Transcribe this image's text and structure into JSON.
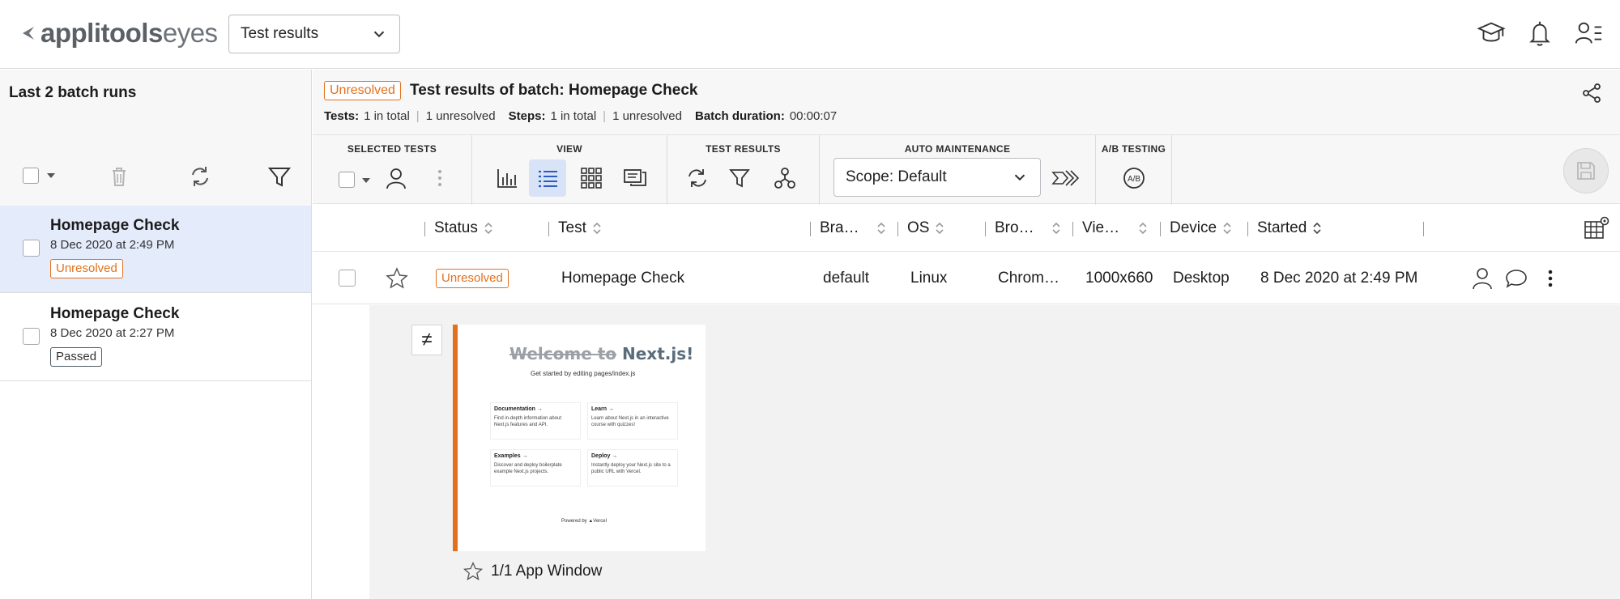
{
  "header": {
    "logo_brand": "applitools",
    "logo_product": "eyes",
    "page_select_value": "Test results",
    "icons": [
      "graduation-cap-icon",
      "bell-icon",
      "user-settings-icon"
    ]
  },
  "sidebar": {
    "title": "Last 2 batch runs",
    "batches": [
      {
        "name": "Homepage Check",
        "date": "8 Dec 2020 at 2:49 PM",
        "status": "Unresolved"
      },
      {
        "name": "Homepage Check",
        "date": "8 Dec 2020 at 2:27 PM",
        "status": "Passed"
      }
    ]
  },
  "batch": {
    "status": "Unresolved",
    "title": "Test results of batch:  Homepage Check",
    "tests_label": "Tests:",
    "tests_total": "1 in total",
    "tests_unresolved": "1 unresolved",
    "steps_label": "Steps:",
    "steps_total": "1 in total",
    "steps_unresolved": "1 unresolved",
    "duration_label": "Batch duration:",
    "duration_value": "00:00:07"
  },
  "toolbar": {
    "selected_tests_label": "SELECTED TESTS",
    "view_label": "VIEW",
    "test_results_label": "TEST RESULTS",
    "auto_maintenance_label": "AUTO MAINTENANCE",
    "ab_testing_label": "A/B TESTING",
    "scope_value": "Scope: Default"
  },
  "table": {
    "columns": [
      "Status",
      "Test",
      "Bra…",
      "OS",
      "Bro…",
      "Vie…",
      "Device",
      "Started"
    ],
    "rows": [
      {
        "status": "Unresolved",
        "test": "Homepage Check",
        "branch": "default",
        "os": "Linux",
        "browser": "Chrom…",
        "viewport": "1000x660",
        "device": "Desktop",
        "started": "8 Dec 2020 at 2:49 PM"
      }
    ]
  },
  "detail": {
    "diff_symbol": "≠",
    "step_label": "1/1 App Window",
    "thumbnail": {
      "title_prefix": "Welcome to",
      "title_main": "Next.js!",
      "subtitle": "Get started by editing  pages/index.js",
      "cards": [
        {
          "title": "Documentation →",
          "desc": "Find in-depth information about Next.js features and API."
        },
        {
          "title": "Learn →",
          "desc": "Learn about Next.js in an interactive course with quizzes!"
        },
        {
          "title": "Examples →",
          "desc": "Discover and deploy boilerplate example Next.js projects."
        },
        {
          "title": "Deploy →",
          "desc": "Instantly deploy your Next.js site to a public URL with Vercel."
        }
      ],
      "footer": "Powered by ▲Vercel"
    }
  },
  "colors": {
    "accent_orange": "#e2711d",
    "selected_row_bg": "#e4ebfb"
  }
}
